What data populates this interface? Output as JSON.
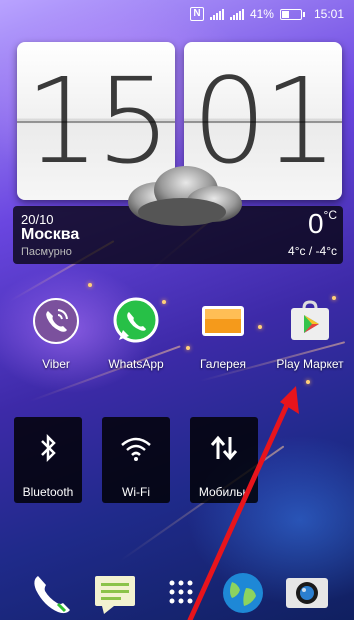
{
  "status_bar": {
    "battery": "41%",
    "battery_level": 0.41,
    "time": "15:01",
    "nfc_icon": "N"
  },
  "clock": {
    "hours": "15",
    "minutes": "01"
  },
  "weather": {
    "date": "20/10",
    "city": "Москва",
    "condition": "Пасмурно",
    "temperature": "0",
    "temperature_unit": "°C",
    "range": "4°c / -4°c",
    "icon": "cloud-icon"
  },
  "apps": [
    {
      "label": "Viber",
      "icon": "viber-icon",
      "color": "#7b519d"
    },
    {
      "label": "WhatsApp",
      "icon": "whatsapp-icon",
      "color": "#27c047"
    },
    {
      "label": "Галерея",
      "icon": "gallery-icon",
      "color": "#f59a1b"
    },
    {
      "label": "Play Маркет",
      "icon": "play-market-icon",
      "color": "#eeeeee"
    }
  ],
  "tiles": [
    {
      "label": "Bluetooth",
      "icon": "bluetooth-icon"
    },
    {
      "label": "Wi-Fi",
      "icon": "wifi-icon"
    },
    {
      "label": "Мобильн",
      "icon": "mobile-data-icon"
    }
  ],
  "dock": [
    {
      "icon": "phone-icon"
    },
    {
      "icon": "messages-icon"
    },
    {
      "icon": "app-drawer-icon"
    },
    {
      "icon": "browser-globe-icon"
    },
    {
      "icon": "camera-icon"
    }
  ],
  "annotation": {
    "arrow_color": "#e8141c"
  }
}
